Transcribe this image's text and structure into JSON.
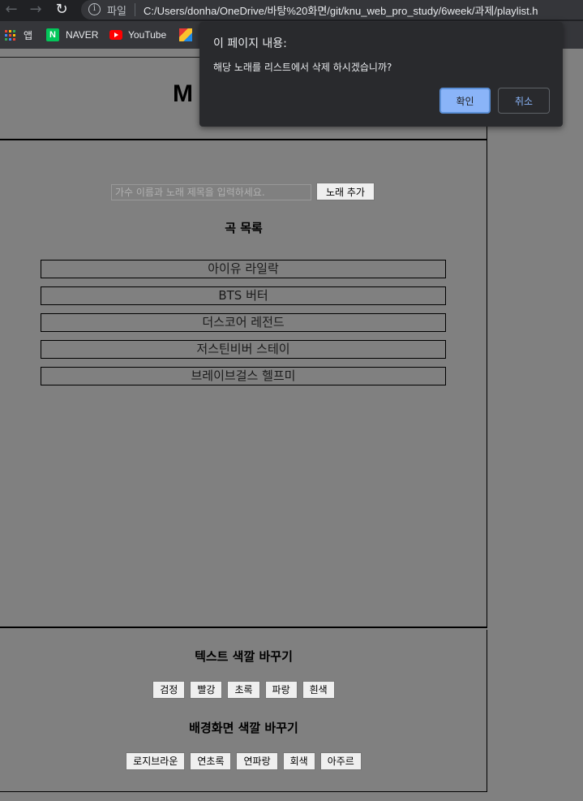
{
  "browser": {
    "scheme_label": "파일",
    "url": "C:/Users/donha/OneDrive/바탕%20화면/git/knu_web_pro_study/6week/과제/playlist.h",
    "bookmarks": [
      {
        "label": "앱",
        "icon": "apps-grid-icon"
      },
      {
        "label": "NAVER",
        "icon": "naver-icon"
      },
      {
        "label": "YouTube",
        "icon": "youtube-icon"
      }
    ]
  },
  "header": {
    "title": "M"
  },
  "main": {
    "input_placeholder": "가수 이름과 노래 제목을 입력하세요.",
    "add_button": "노래 추가",
    "list_title": "곡 목록",
    "songs": [
      "아이유 라일락",
      "BTS 버터",
      "더스코어 레전드",
      "저스틴비버 스테이",
      "브레이브걸스 헬프미"
    ]
  },
  "footer": {
    "text_color_title": "텍스트 색깔 바꾸기",
    "text_colors": [
      "검정",
      "빨강",
      "초록",
      "파랑",
      "흰색"
    ],
    "bg_color_title": "배경화면 색깔 바꾸기",
    "bg_colors": [
      "로지브라운",
      "연초록",
      "연파랑",
      "회색",
      "아주르"
    ]
  },
  "dialog": {
    "title": "이 페이지 내용:",
    "message": "해당 노래를 리스트에서 삭제 하시겠습니까?",
    "ok_label": "확인",
    "cancel_label": "취소"
  },
  "colors": {
    "page_overlay": "#808080",
    "dialog_bg": "#292a2d",
    "dialog_accent": "#8ab4f8"
  }
}
